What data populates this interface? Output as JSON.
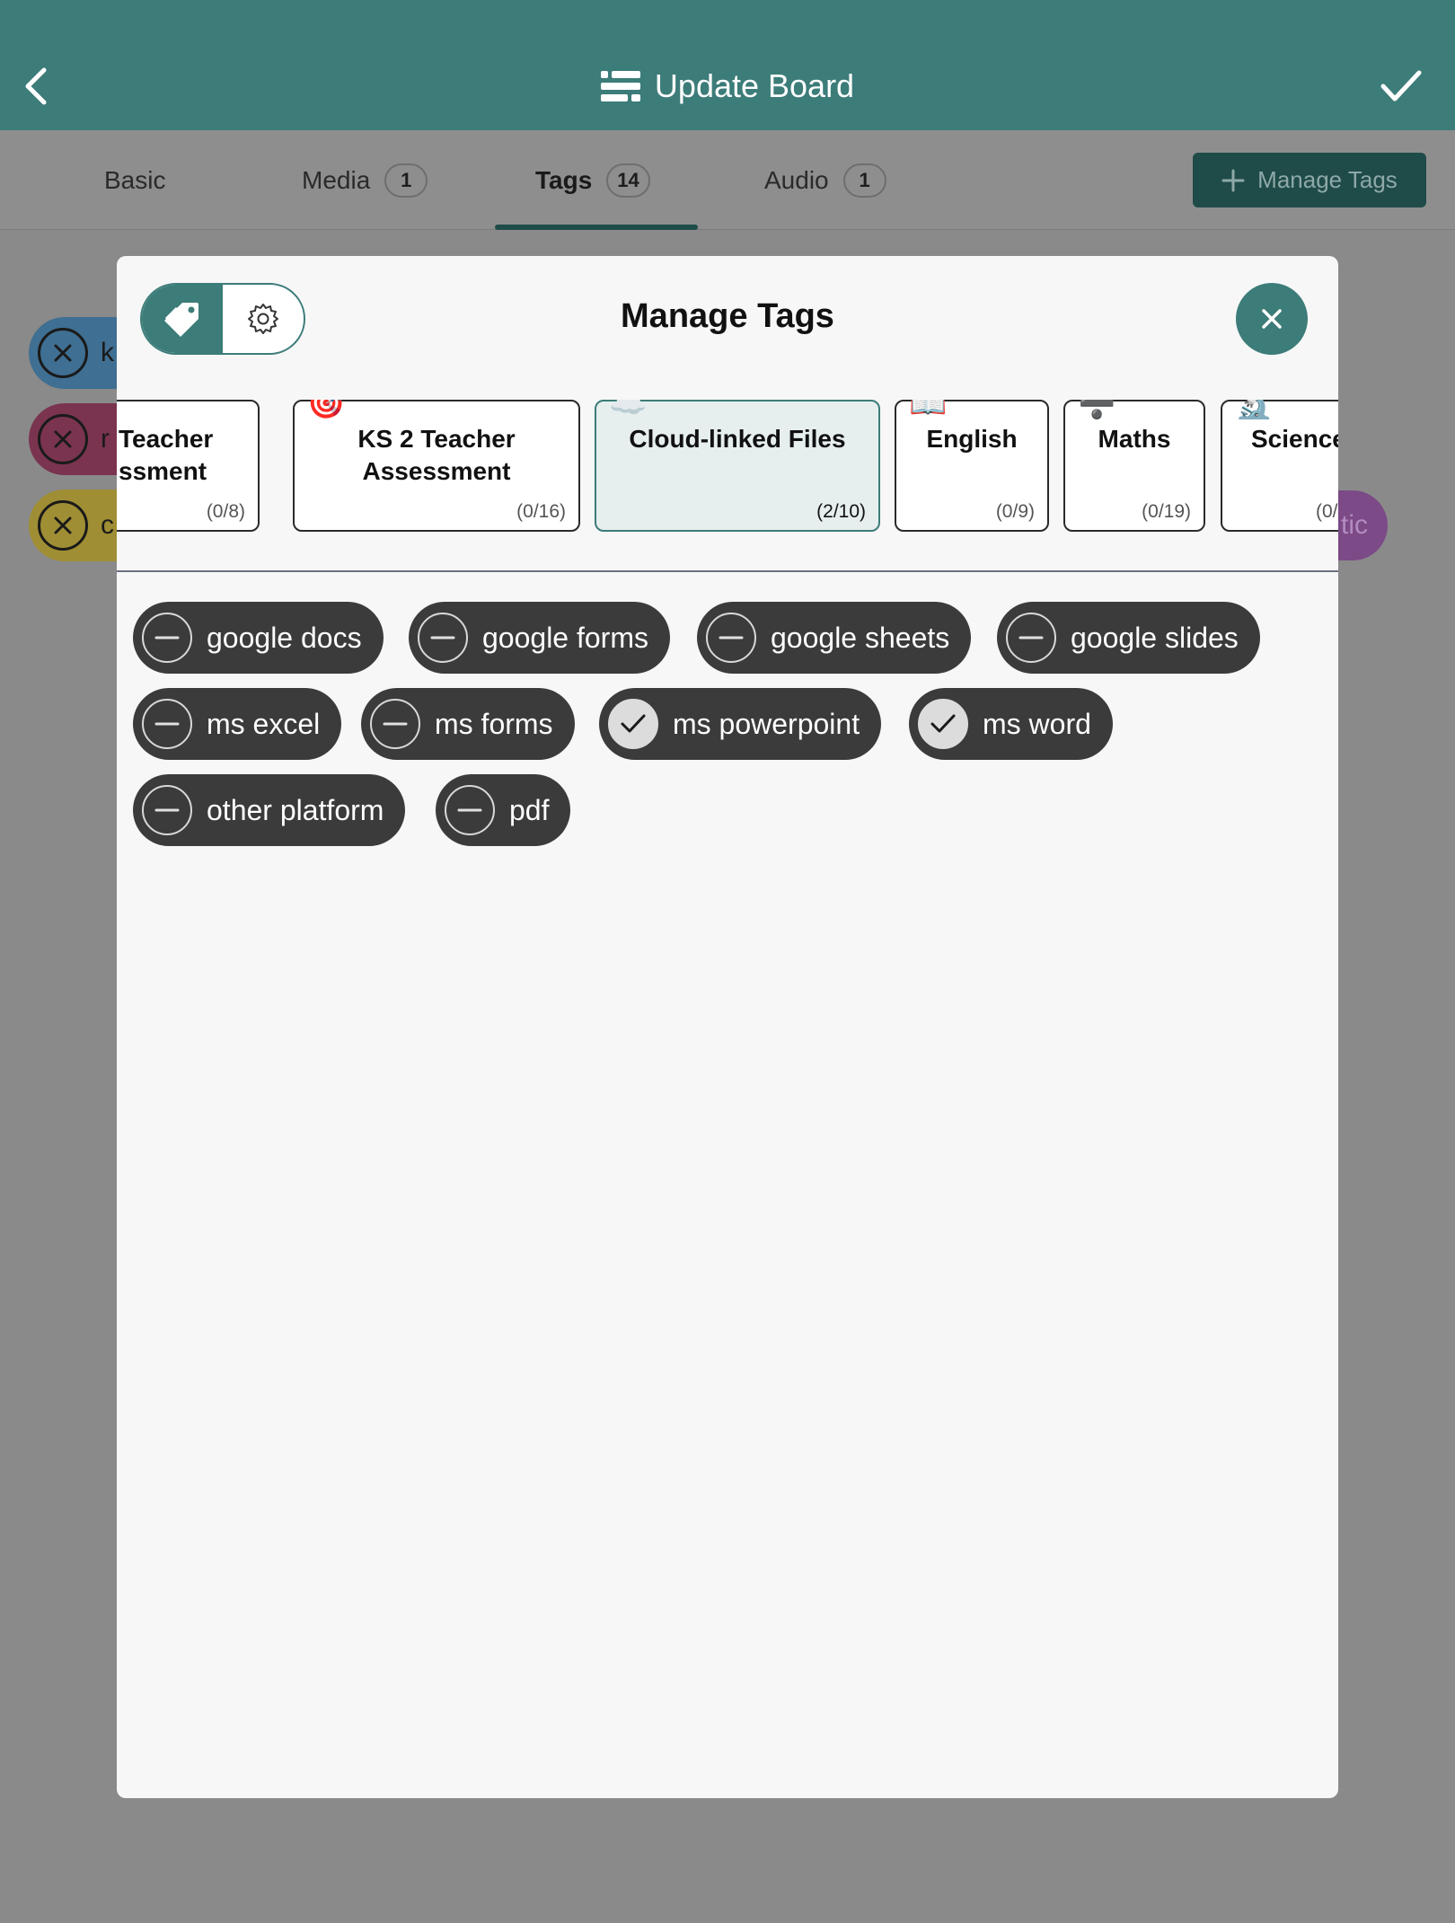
{
  "header": {
    "title": "Update Board",
    "background": "#3c7c79"
  },
  "tabs": [
    {
      "label": "Basic",
      "count": null
    },
    {
      "label": "Media",
      "count": "1"
    },
    {
      "label": "Tags",
      "count": "14"
    },
    {
      "label": "Audio",
      "count": "1"
    }
  ],
  "active_tab": "Tags",
  "manage_tags_button": "Manage Tags",
  "background_chips": [
    {
      "text": "k",
      "color": "#4a7fa6"
    },
    {
      "text": "r",
      "color": "#8a3a5a"
    },
    {
      "text": "c",
      "color": "#b4a03c"
    }
  ],
  "background_purple_chip": "tic",
  "modal": {
    "title": "Manage Tags",
    "categories": [
      {
        "name": "Teacher\nssment",
        "count": "(0/8)",
        "icon": ""
      },
      {
        "name": "KS 2 Teacher Assessment",
        "count": "(0/16)",
        "icon": "🎯"
      },
      {
        "name": "Cloud-linked Files",
        "count": "(2/10)",
        "icon": "☁️",
        "active": true
      },
      {
        "name": "English",
        "count": "(0/9)",
        "icon": "📖"
      },
      {
        "name": "Maths",
        "count": "(0/19)",
        "icon": "➗"
      },
      {
        "name": "Science",
        "count": "(0/",
        "icon": "🔬"
      }
    ],
    "tags": [
      {
        "label": "google docs",
        "checked": false
      },
      {
        "label": "google forms",
        "checked": false
      },
      {
        "label": "google sheets",
        "checked": false
      },
      {
        "label": "google slides",
        "checked": false
      },
      {
        "label": "ms excel",
        "checked": false
      },
      {
        "label": "ms forms",
        "checked": false
      },
      {
        "label": "ms powerpoint",
        "checked": true
      },
      {
        "label": "ms word",
        "checked": true
      },
      {
        "label": "other platform",
        "checked": false
      },
      {
        "label": "pdf",
        "checked": false
      }
    ]
  }
}
